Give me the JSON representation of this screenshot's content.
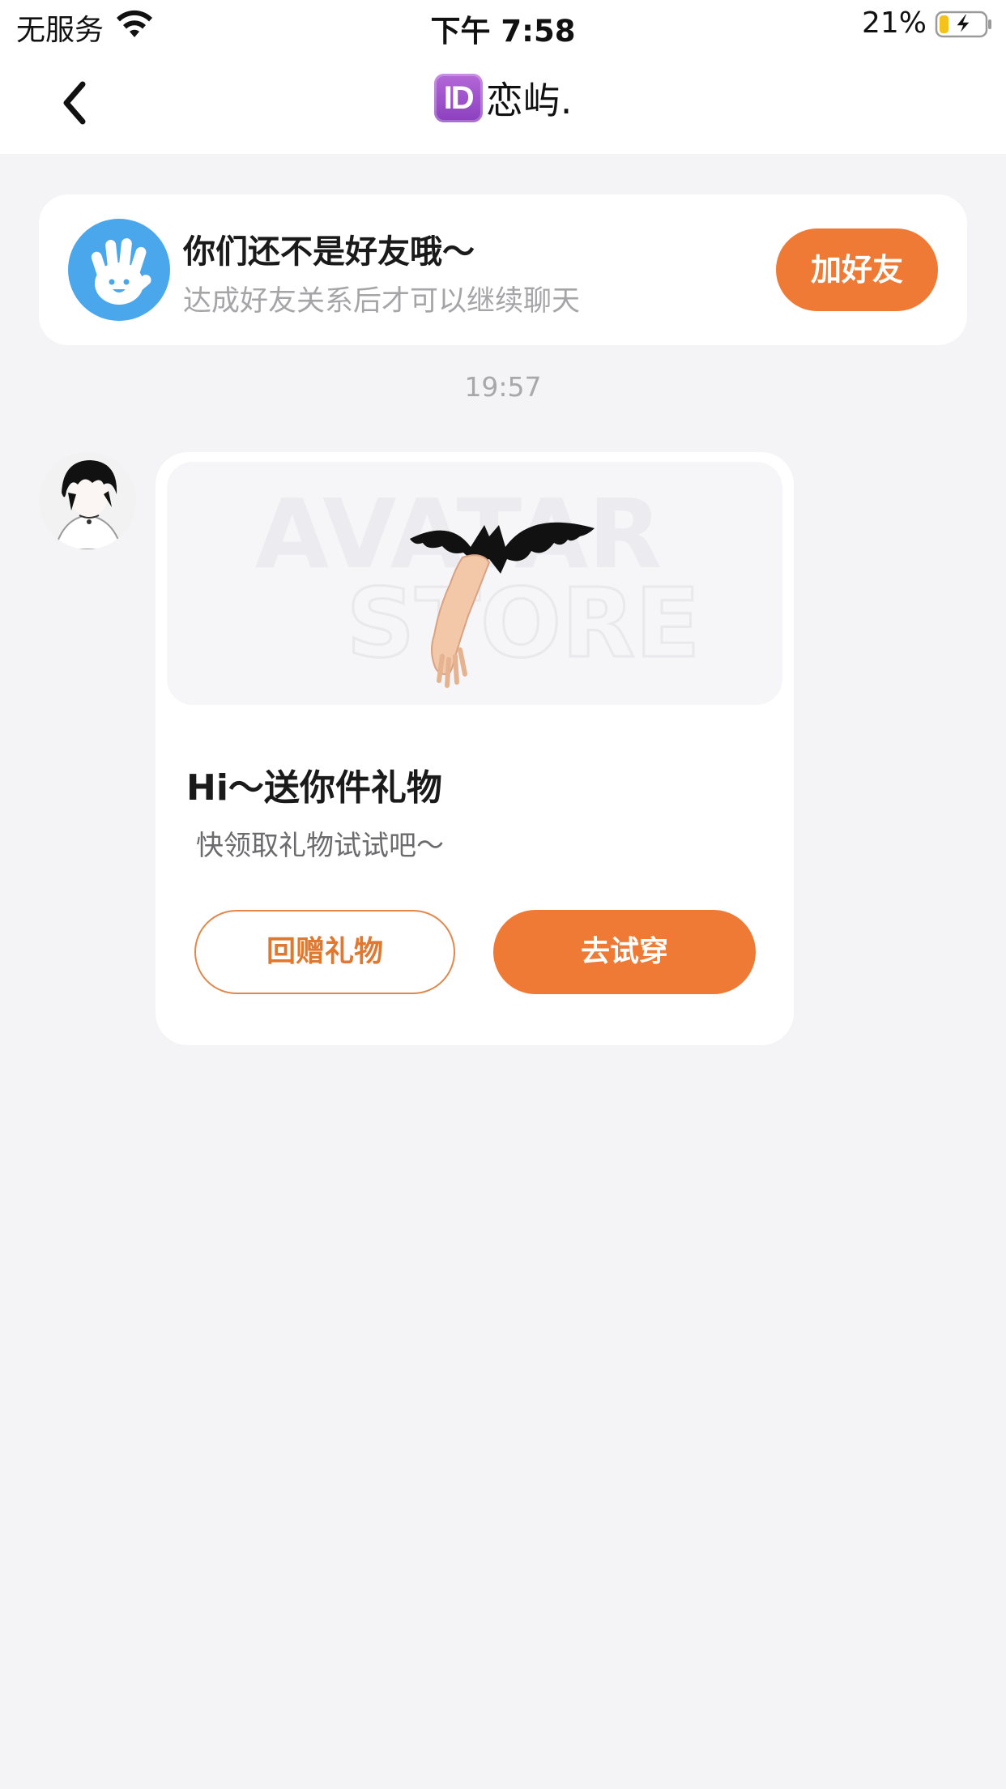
{
  "status_bar": {
    "carrier": "无服务",
    "time": "下午 7:58",
    "battery_percent": "21%",
    "battery_level": 0.21,
    "charging": true
  },
  "nav": {
    "badge": "ID",
    "title": "恋屿."
  },
  "friend_banner": {
    "title": "你们还不是好友哦～",
    "subtitle": "达成好友关系后才可以继续聊天",
    "add_button": "加好友"
  },
  "chat": {
    "timestamp": "19:57",
    "gift_card": {
      "watermark_line1": "AVATAR",
      "watermark_line2": "STORE",
      "title": "Hi～送你件礼物",
      "subtitle": "快领取礼物试试吧～",
      "return_button": "回赠礼物",
      "try_button": "去试穿"
    }
  },
  "colors": {
    "accent": "#ee7a36",
    "background": "#f4f3f6",
    "avatar_blue": "#4aa7ec"
  }
}
